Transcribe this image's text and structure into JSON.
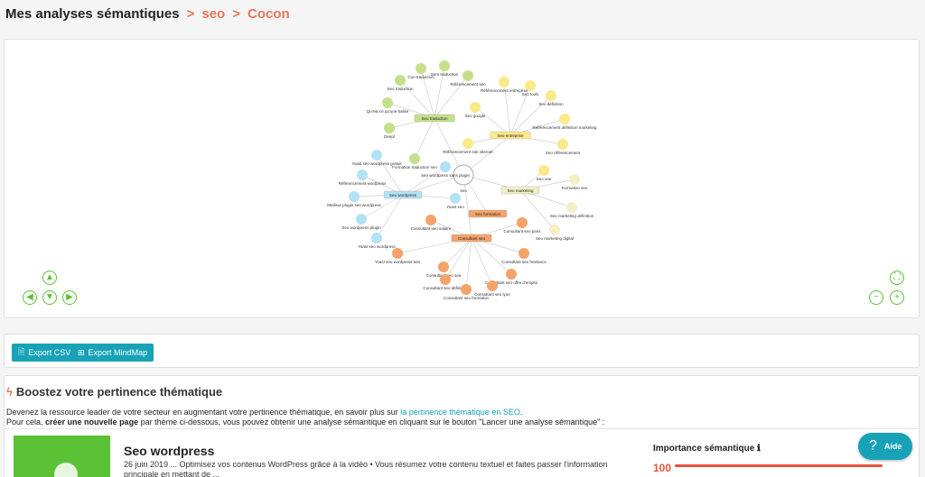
{
  "breadcrumb": {
    "title": "Mes analyses sémantiques",
    "sep1": ">",
    "crumb1": "seo",
    "sep2": ">",
    "crumb2": "Cocon"
  },
  "graph": {
    "colors": {
      "green": "#c5e08a",
      "yellow": "#fbe98a",
      "blue": "#b3e2f5",
      "orange": "#f4a36a",
      "beige": "#f3f0c5",
      "edge": "#cfcfcf",
      "root_stroke": "#aaaaaa"
    },
    "root": {
      "id": "r",
      "label": "seo"
    },
    "hubs": [
      {
        "id": "h1",
        "label": "Seo traduction",
        "color": "green"
      },
      {
        "id": "h2",
        "label": "Seo entreprise",
        "color": "yellow"
      },
      {
        "id": "h3",
        "label": "Seo wordpress",
        "color": "blue"
      },
      {
        "id": "h4",
        "label": "Seo marketing",
        "color": "beige"
      },
      {
        "id": "h5",
        "label": "Seo formation",
        "color": "orange"
      },
      {
        "id": "h6",
        "label": "Consultant seo",
        "color": "orange"
      }
    ],
    "leaves": [
      {
        "id": "g1",
        "label": "Seo traduction",
        "color": "green"
      },
      {
        "id": "g2",
        "label": "Con traduction",
        "color": "green"
      },
      {
        "id": "g3",
        "label": "Sem traduction",
        "color": "green"
      },
      {
        "id": "g4",
        "label": "Référencement seo",
        "color": "green"
      },
      {
        "id": "g5",
        "label": "Qu'est-ce qu'une balise",
        "color": "green"
      },
      {
        "id": "g6",
        "label": "Deepl",
        "color": "green"
      },
      {
        "id": "g7",
        "label": "Formation traduction seo",
        "color": "green"
      },
      {
        "id": "y1",
        "label": "Référencement entreprise",
        "color": "yellow"
      },
      {
        "id": "y2",
        "label": "Seo tools",
        "color": "yellow"
      },
      {
        "id": "y3",
        "label": "Seo définition",
        "color": "yellow"
      },
      {
        "id": "y4",
        "label": "Seo google",
        "color": "yellow"
      },
      {
        "id": "y5",
        "label": "Référencement définition marketing",
        "color": "yellow"
      },
      {
        "id": "y6",
        "label": "Seo référencement",
        "color": "yellow"
      },
      {
        "id": "y7",
        "label": "Référencement site internet",
        "color": "yellow"
      },
      {
        "id": "y8",
        "label": "Seo one",
        "color": "yellow"
      },
      {
        "id": "b1",
        "label": "Yoast seo wordpress gratuit",
        "color": "blue"
      },
      {
        "id": "b2",
        "label": "Référencement wordpress",
        "color": "blue"
      },
      {
        "id": "b3",
        "label": "Seo wordpress sans plugin",
        "color": "blue"
      },
      {
        "id": "b4",
        "label": "Meilleur plugin seo wordpress",
        "color": "blue"
      },
      {
        "id": "b5",
        "label": "Yoast seo",
        "color": "blue"
      },
      {
        "id": "b6",
        "label": "Seo wordpress plugin",
        "color": "blue"
      },
      {
        "id": "b7",
        "label": "Yoast seo wordpress",
        "color": "blue"
      },
      {
        "id": "e1",
        "label": "Formation seo",
        "color": "beige"
      },
      {
        "id": "e2",
        "label": "Seo marketing définition",
        "color": "beige"
      },
      {
        "id": "e3",
        "label": "Seo marketing digital",
        "color": "beige"
      },
      {
        "id": "o1",
        "label": "Consultant seo salaire",
        "color": "orange"
      },
      {
        "id": "o2",
        "label": "Consultant seo paris",
        "color": "orange"
      },
      {
        "id": "o3",
        "label": "Yoast seo wordpress tuto",
        "color": "orange"
      },
      {
        "id": "o4",
        "label": "Consultant seo freelance",
        "color": "orange"
      },
      {
        "id": "o5",
        "label": "Consultant seo sea",
        "color": "orange"
      },
      {
        "id": "o6",
        "label": "Consultant seo offre d'emploi",
        "color": "orange"
      },
      {
        "id": "o7",
        "label": "Consultant seo définition",
        "color": "orange"
      },
      {
        "id": "o8",
        "label": "Consultant seo formation",
        "color": "orange"
      },
      {
        "id": "o9",
        "label": "Consultant seo lyon",
        "color": "orange"
      }
    ]
  },
  "controls": {
    "up": "up-arrow",
    "left": "left-arrow",
    "down": "down-arrow",
    "right": "right-arrow",
    "fit": "fit-screen",
    "zoom_out": "zoom-out",
    "zoom_in": "zoom-in"
  },
  "export": {
    "csv": "Export CSV",
    "mindmap": "Export MindMap"
  },
  "boost": {
    "title": "Boostez votre pertinence thématique",
    "line1_prefix": "Devenez la ressource leader de votre secteur en augmentant votre pertinence thématique, en savoir plus sur ",
    "line1_link": "la pertinence thématique en SEO",
    "line1_suffix": ".",
    "line2_prefix": "Pour cela, ",
    "line2_bold": "créer une nouvelle page",
    "line2_suffix": " par thème ci-dessous, vous pouvez obtenir une analyse sémantique en cliquant sur le bouton \"Lancer une analyse sémantique\" :"
  },
  "card": {
    "title": "Seo wordpress",
    "desc": "26 juin 2019 ... Optimisez vos contenus WordPress grâce à la vidéo • Vous résumez votre contenu textuel et faites passer l'information principale en mettant de ...",
    "importance_label": "Importance sémantique",
    "info_icon": "info-icon",
    "importance_value": "100"
  },
  "help": {
    "label": "Aide"
  }
}
